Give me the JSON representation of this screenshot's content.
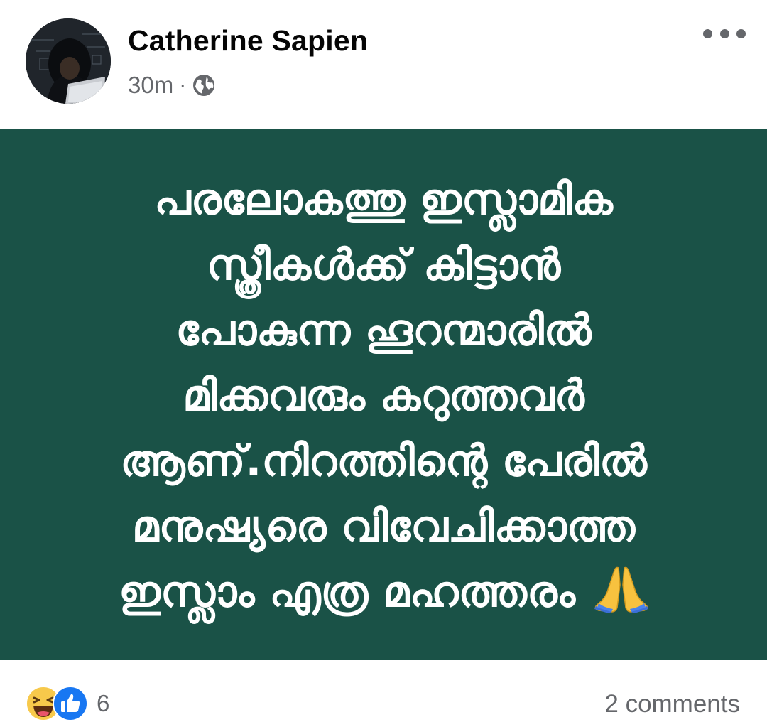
{
  "post": {
    "author_name": "Catherine Sapien",
    "timestamp": "30m",
    "separator": "·",
    "privacy_icon": "globe-icon",
    "more_icon": "more-options-icon"
  },
  "content": {
    "background_color": "#1a5247",
    "text": "പരലോകത്തു ഇസ്ലാമിക\nസ്ത്രീകൾക്ക് കിട്ടാൻ\nപോകുന്ന ഹൂറന്മാരിൽ\nമിക്കവരും കറുത്തവർ\nആണ്.നിറത്തിന്റെ പേരിൽ\nമനുഷ്യരെ വിവേചിക്കാത്ത\nഇസ്ലാം എത്ര മഹത്തരം",
    "emoji": "folded-hands-emoji"
  },
  "footer": {
    "reaction_icons": [
      "laughing-emoji-icon",
      "like-icon"
    ],
    "reaction_count": "6",
    "comments_label": "2 comments"
  }
}
